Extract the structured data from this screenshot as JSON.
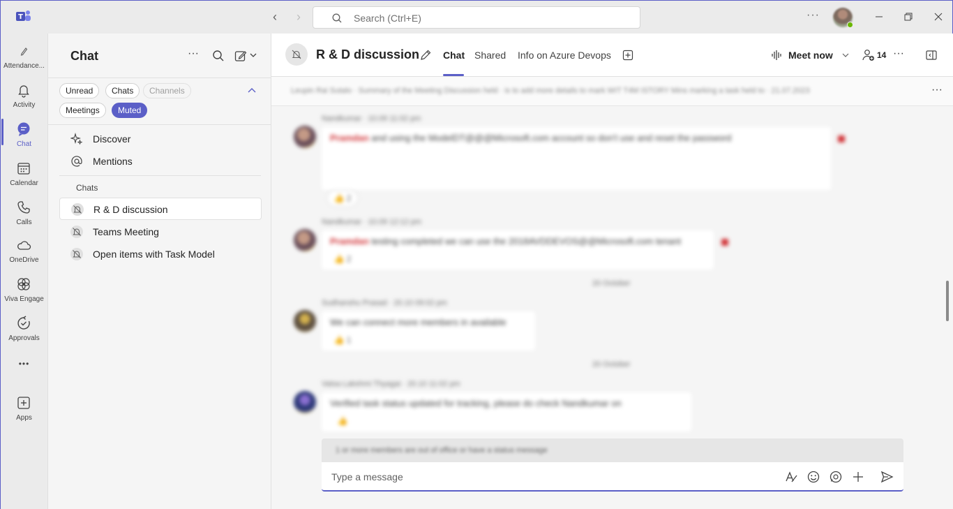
{
  "titlebar": {
    "search_placeholder": "Search (Ctrl+E)",
    "more": "···"
  },
  "rail": {
    "items": [
      {
        "label": "Attendance...",
        "icon": "attendance-icon"
      },
      {
        "label": "Activity",
        "icon": "bell-icon"
      },
      {
        "label": "Chat",
        "icon": "chat-icon",
        "active": true
      },
      {
        "label": "Calendar",
        "icon": "calendar-icon"
      },
      {
        "label": "Calls",
        "icon": "phone-icon"
      },
      {
        "label": "OneDrive",
        "icon": "cloud-icon"
      },
      {
        "label": "Viva Engage",
        "icon": "viva-engage-icon"
      },
      {
        "label": "Approvals",
        "icon": "approvals-icon"
      },
      {
        "label": "",
        "icon": "more-icon"
      },
      {
        "label": "Apps",
        "icon": "add-app-icon"
      }
    ],
    "more_label": "•••"
  },
  "list": {
    "title": "Chat",
    "more": "···",
    "filters": [
      {
        "label": "Unread",
        "state": "normal"
      },
      {
        "label": "Chats",
        "state": "normal"
      },
      {
        "label": "Channels",
        "state": "dim"
      },
      {
        "label": "Meetings",
        "state": "normal"
      },
      {
        "label": "Muted",
        "state": "active"
      }
    ],
    "nav": [
      {
        "label": "Discover"
      },
      {
        "label": "Mentions"
      }
    ],
    "section_label": "Chats",
    "chats": [
      {
        "label": "R & D discussion",
        "selected": true
      },
      {
        "label": "Teams Meeting"
      },
      {
        "label": "Open items with Task Model"
      }
    ]
  },
  "main": {
    "title": "R & D discussion",
    "tabs": [
      {
        "label": "Chat",
        "active": true
      },
      {
        "label": "Shared"
      },
      {
        "label": "Info on Azure Devops"
      }
    ],
    "meet_now": "Meet now",
    "participant_count": "14",
    "more": "···",
    "pinned_text": "Leupin Rai Sutalo · Summary of the Meeting Discussion held · is to add more details to mark WIT T4M ISTORY Mins marking a task held to · 21.07.2023",
    "pinned_more": "···",
    "messages": [
      {
        "meta": "Nandkumar · 10.09 11:02 pm",
        "mention": "Pramdan",
        "text": "and using the ModelDT@@@Microsoft.com account so don't use and reset the password",
        "reaction": "👍 2"
      },
      {
        "meta": "Nandkumar · 10.09 12:12 pm",
        "mention": "Pramdan",
        "text": "testing completed we can use the 2018AVDDEVOS@@Microsoft.com tenant",
        "reaction": "👍 2"
      },
      {
        "date": "20 October"
      },
      {
        "meta": "Sudhanshu Prasad · 20.10 09:02 pm",
        "text": "We can connect more members in available",
        "reaction": "👍 1"
      },
      {
        "date": "20 October"
      },
      {
        "meta": "Vatsa Lakshmi Thyagai · 20.10 11:02 pm",
        "text": "Verified task status updated for tracking, please do check Nandkumar on",
        "reaction": "👍"
      }
    ],
    "ooo_text": "1 or more members are out of office or have a status message",
    "compose_placeholder": "Type a message"
  },
  "colors": {
    "accent": "#5b5fc7",
    "mention": "#d13438",
    "presence": "#6bb700"
  }
}
